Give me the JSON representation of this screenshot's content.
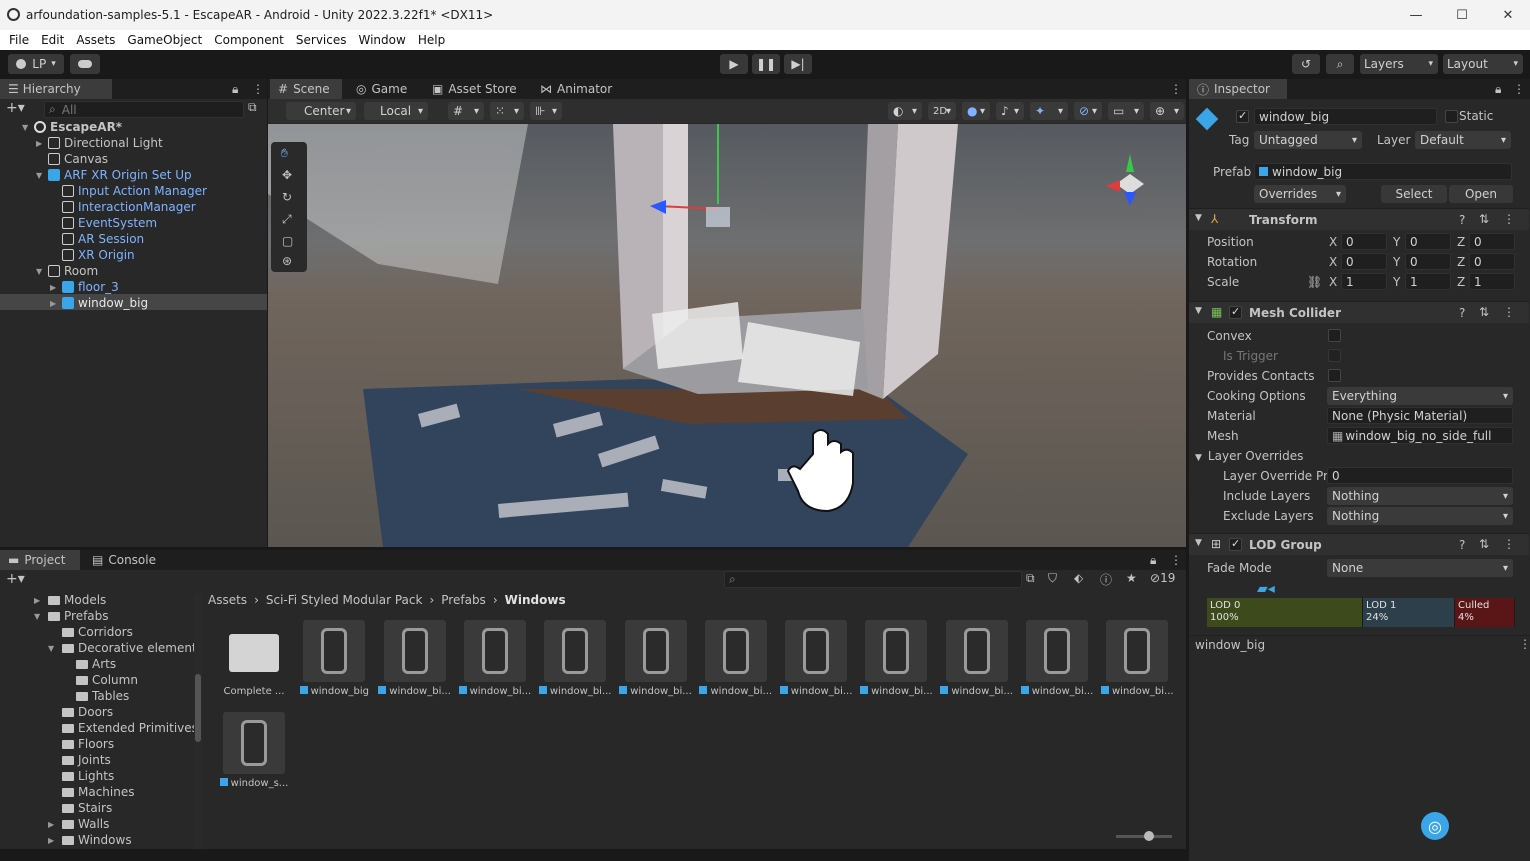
{
  "window": {
    "title": "arfoundation-samples-5.1 - EscapeAR - Android - Unity 2022.3.22f1* <DX11>",
    "minimize": "—",
    "maximize": "☐",
    "close": "✕"
  },
  "menu": [
    "File",
    "Edit",
    "Assets",
    "GameObject",
    "Component",
    "Services",
    "Window",
    "Help"
  ],
  "toolbar": {
    "account": "LP",
    "layers": "Layers",
    "layout": "Layout"
  },
  "hierarchy": {
    "tab": "Hierarchy",
    "search_placeholder": "All",
    "items": [
      {
        "label": "EscapeAR*",
        "depth": 0,
        "kind": "scene"
      },
      {
        "label": "Directional Light",
        "depth": 1,
        "kind": "obj"
      },
      {
        "label": "Canvas",
        "depth": 1,
        "kind": "obj"
      },
      {
        "label": "ARF XR Origin Set Up",
        "depth": 1,
        "kind": "prefab"
      },
      {
        "label": "Input Action Manager",
        "depth": 2,
        "kind": "obj-blue"
      },
      {
        "label": "InteractionManager",
        "depth": 2,
        "kind": "obj-blue"
      },
      {
        "label": "EventSystem",
        "depth": 2,
        "kind": "obj-blue"
      },
      {
        "label": "AR Session",
        "depth": 2,
        "kind": "obj-blue"
      },
      {
        "label": "XR Origin",
        "depth": 2,
        "kind": "obj-blue"
      },
      {
        "label": "Room",
        "depth": 1,
        "kind": "obj"
      },
      {
        "label": "floor_3",
        "depth": 2,
        "kind": "prefab"
      },
      {
        "label": "window_big",
        "depth": 2,
        "kind": "prefab-selected"
      }
    ]
  },
  "scene": {
    "tabs": [
      "Scene",
      "Game",
      "Asset Store",
      "Animator"
    ],
    "pivot": "Center",
    "space": "Local",
    "mode_2d": "2D"
  },
  "inspector": {
    "tab": "Inspector",
    "name": "window_big",
    "static_label": "Static",
    "tag_label": "Tag",
    "tag": "Untagged",
    "layer_label": "Layer",
    "layer": "Default",
    "prefab_label": "Prefab",
    "prefab": "window_big",
    "overrides": "Overrides",
    "select": "Select",
    "open": "Open",
    "transform": {
      "title": "Transform",
      "position_label": "Position",
      "rotation_label": "Rotation",
      "scale_label": "Scale",
      "x": "X",
      "y": "Y",
      "z": "Z",
      "position": [
        "0",
        "0",
        "0"
      ],
      "rotation": [
        "0",
        "0",
        "0"
      ],
      "scale": [
        "1",
        "1",
        "1"
      ]
    },
    "mesh_collider": {
      "title": "Mesh Collider",
      "convex": "Convex",
      "is_trigger": "Is Trigger",
      "provides_contacts": "Provides Contacts",
      "cooking_options_label": "Cooking Options",
      "cooking_options": "Everything",
      "material_label": "Material",
      "material": "None (Physic Material)",
      "mesh_label": "Mesh",
      "mesh": "window_big_no_side_full",
      "layer_overrides": "Layer Overrides",
      "layer_override_priority_label": "Layer Override Pri",
      "layer_override_priority": "0",
      "include_layers_label": "Include Layers",
      "include_layers": "Nothing",
      "exclude_layers_label": "Exclude Layers",
      "exclude_layers": "Nothing"
    },
    "lod_group": {
      "title": "LOD Group",
      "fade_mode_label": "Fade Mode",
      "fade_mode": "None",
      "lods": [
        {
          "name": "LOD 0",
          "pct": "100%",
          "color": "#3d4a1c"
        },
        {
          "name": "LOD 1",
          "pct": "24%",
          "color": "#2c3f4b"
        },
        {
          "name": "Culled",
          "pct": "4%",
          "color": "#5a1616"
        }
      ]
    },
    "footer": "window_big"
  },
  "project": {
    "tabs": [
      "Project",
      "Console"
    ],
    "badge": "19",
    "breadcrumb": [
      "Assets",
      "Sci-Fi Styled Modular Pack",
      "Prefabs",
      "Windows"
    ],
    "tree": [
      {
        "label": "Models",
        "depth": 1
      },
      {
        "label": "Prefabs",
        "depth": 1
      },
      {
        "label": "Corridors",
        "depth": 2
      },
      {
        "label": "Decorative element",
        "depth": 2
      },
      {
        "label": "Arts",
        "depth": 3
      },
      {
        "label": "Column",
        "depth": 3
      },
      {
        "label": "Tables",
        "depth": 3
      },
      {
        "label": "Doors",
        "depth": 2
      },
      {
        "label": "Extended Primitives",
        "depth": 2
      },
      {
        "label": "Floors",
        "depth": 2
      },
      {
        "label": "Joints",
        "depth": 2
      },
      {
        "label": "Lights",
        "depth": 2
      },
      {
        "label": "Machines",
        "depth": 2
      },
      {
        "label": "Stairs",
        "depth": 2
      },
      {
        "label": "Walls",
        "depth": 2
      },
      {
        "label": "Windows",
        "depth": 2
      }
    ],
    "assets": [
      "Complete ...",
      "window_big",
      "window_bi...",
      "window_bi...",
      "window_bi...",
      "window_bi...",
      "window_bi...",
      "window_bi...",
      "window_bi...",
      "window_bi...",
      "window_bi...",
      "window_bi...",
      "window_s..."
    ]
  }
}
